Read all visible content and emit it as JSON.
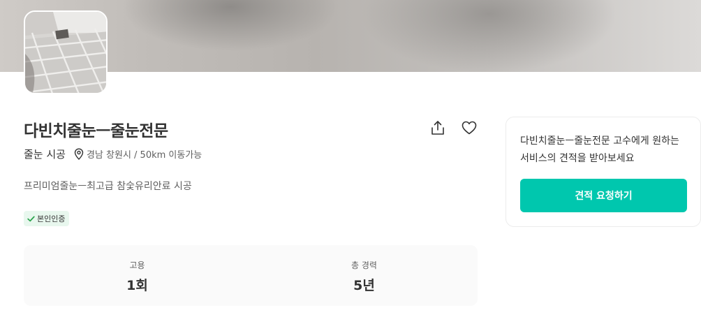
{
  "profile": {
    "name": "다빈치줄눈ㅡ줄눈전문",
    "category": "줄눈 시공",
    "location": "경남 창원시 / 50km 이동가능",
    "description": "프리미엄줄눈ㅡ최고급 참숯유리안료 시공",
    "badge": "본인인증"
  },
  "actions": {
    "share_icon": "share-icon",
    "like_icon": "heart-icon"
  },
  "stats": [
    {
      "label": "고용",
      "value": "1회"
    },
    {
      "label": "총 경력",
      "value": "5년"
    }
  ],
  "quote_card": {
    "text": "다빈치줄눈ㅡ줄눈전문 고수에게 원하는 서비스의 견적을 받아보세요",
    "button_label": "견적 요청하기"
  },
  "colors": {
    "accent": "#00c7ae",
    "badge_bg": "#e8f7ee",
    "badge_check": "#2ea54f"
  }
}
